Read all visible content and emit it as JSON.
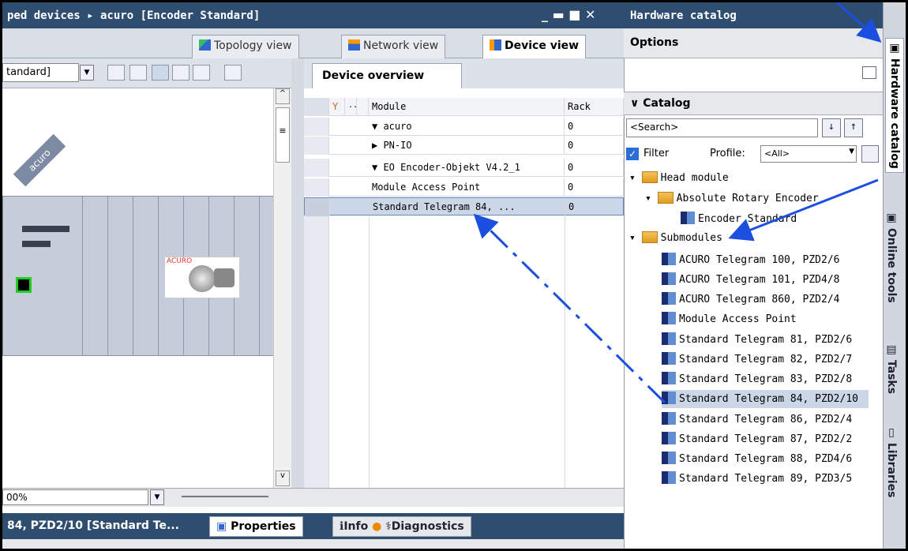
{
  "title": {
    "text": "ped devices ▸ acuro [Encoder Standard]"
  },
  "window_controls": "_ ▬ ■ ✕",
  "views": {
    "topology": "Topology view",
    "network": "Network view",
    "device": "Device view"
  },
  "toolbar": {
    "device_select": "tandard]",
    "zoom": "00%"
  },
  "canvas": {
    "device_tag": "acuro",
    "image_label": "ACURO"
  },
  "overview": {
    "tab": "Device overview",
    "headers": {
      "module": "Module",
      "rack": "Rack",
      "dots": "..."
    },
    "rows": [
      {
        "module": "▼  acuro",
        "rack": "0"
      },
      {
        "module": "   ▶  PN-IO",
        "rack": "0"
      },
      {
        "module": "▼  EO Encoder-Objekt V4.2_1",
        "rack": "0"
      },
      {
        "module": "      Module Access Point",
        "rack": "0"
      },
      {
        "module": "      Standard Telegram 84, ...",
        "rack": "0"
      }
    ]
  },
  "bottom": {
    "status": "84, PZD2/10 [Standard Te...",
    "properties": "Properties",
    "info": "Info",
    "diagnostics": "Diagnostics"
  },
  "catalog": {
    "header": "Hardware catalog",
    "options": "Options",
    "section": "Catalog",
    "search_placeholder": "<Search>",
    "filter_label": "Filter",
    "profile_label": "Profile:",
    "profile_value": "<All>",
    "tree": {
      "head_module": "Head module",
      "absolute_rotary": "Absolute Rotary Encoder",
      "encoder_standard": "Encoder Standard",
      "submodules": "Submodules",
      "items": [
        "ACURO Telegram 100, PZD2/6",
        "ACURO Telegram 101, PZD4/8",
        "ACURO Telegram 860, PZD2/4",
        "Module Access Point",
        "Standard Telegram 81, PZD2/6",
        "Standard Telegram 82, PZD2/7",
        "Standard Telegram 83, PZD2/8",
        "Standard Telegram 84, PZD2/10",
        "Standard Telegram 86, PZD2/4",
        "Standard Telegram 87, PZD2/2",
        "Standard Telegram 88, PZD4/6",
        "Standard Telegram 89, PZD3/5"
      ]
    }
  },
  "side_tabs": {
    "hardware_catalog": "Hardware catalog",
    "online_tools": "Online tools",
    "tasks": "Tasks",
    "libraries": "Libraries"
  }
}
